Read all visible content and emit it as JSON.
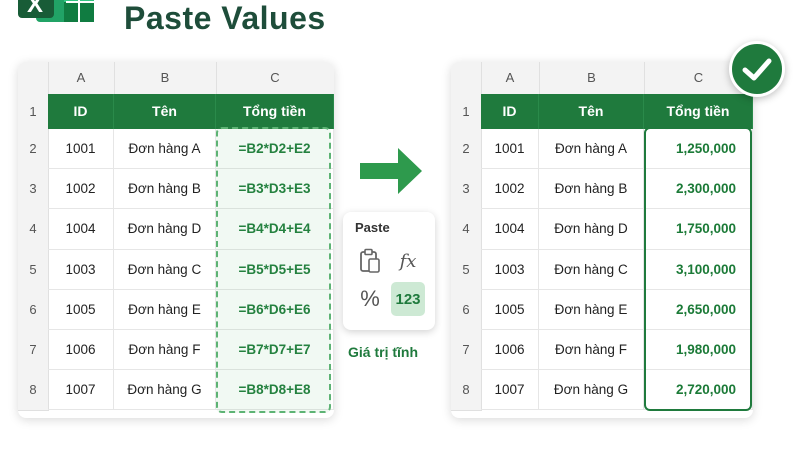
{
  "title": "Paste Values",
  "column_headers": [
    "A",
    "B",
    "C"
  ],
  "row_numbers": [
    "1",
    "2",
    "3",
    "4",
    "5",
    "6",
    "7",
    "8"
  ],
  "table_headers": [
    "ID",
    "Tên",
    "Tổng tiền"
  ],
  "left_table": {
    "rows": [
      [
        "1001",
        "Đơn hàng A",
        "=B2*D2+E2"
      ],
      [
        "1002",
        "Đơn hàng B",
        "=B3*D3+E3"
      ],
      [
        "1004",
        "Đơn hàng D",
        "=B4*D4+E4"
      ],
      [
        "1003",
        "Đơn hàng C",
        "=B5*D5+E5"
      ],
      [
        "1005",
        "Đơn hàng E",
        "=B6*D6+E6"
      ],
      [
        "1006",
        "Đơn hàng F",
        "=B7*D7+E7"
      ],
      [
        "1007",
        "Đơn hàng G",
        "=B8*D8+E8"
      ]
    ]
  },
  "right_table": {
    "rows": [
      [
        "1001",
        "Đơn hàng A",
        "1,250,000"
      ],
      [
        "1002",
        "Đơn hàng B",
        "2,300,000"
      ],
      [
        "1004",
        "Đơn hàng D",
        "1,750,000"
      ],
      [
        "1003",
        "Đơn hàng C",
        "3,100,000"
      ],
      [
        "1005",
        "Đơn hàng E",
        "2,650,000"
      ],
      [
        "1006",
        "Đơn hàng F",
        "1,980,000"
      ],
      [
        "1007",
        "Đơn hàng G",
        "2,720,000"
      ]
    ]
  },
  "paste_panel": {
    "title": "Paste",
    "options": [
      {
        "icon": "clipboard-icon",
        "label": ""
      },
      {
        "icon": "fx-icon",
        "label": "fx"
      },
      {
        "icon": "percent-icon",
        "label": "%"
      },
      {
        "icon": "values-icon",
        "label": "123"
      }
    ],
    "caption": "Giá trị tĩnh"
  },
  "colors": {
    "brand_green": "#1f7a3d",
    "title_color": "#1e4d3a",
    "formula_color": "#1b7a37"
  }
}
